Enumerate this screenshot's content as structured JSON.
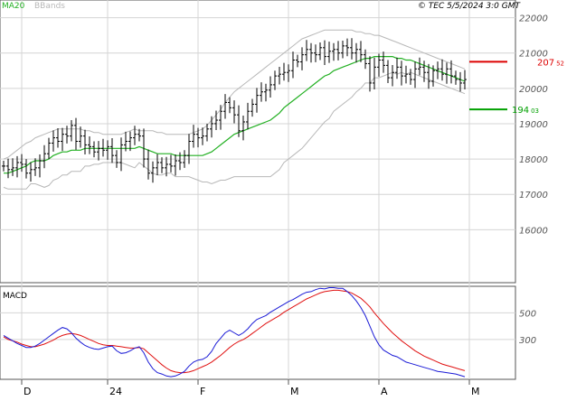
{
  "header": {
    "legend_ma20": "MA20",
    "legend_bbands": "BBands",
    "copyright": "© TEC 5/5/2024 3:0 GMT"
  },
  "colors": {
    "ma20": "#22b022",
    "bbands": "#b8b8b8",
    "macd_line": "#1a1ad6",
    "signal_line": "#e01010",
    "bars": "#000000",
    "resistance": "#dd0000",
    "support": "#00a000",
    "grid": "#d4d4d4"
  },
  "chart_data": [
    {
      "type": "line",
      "subtype": "ohlc-bars",
      "ylim": [
        14500,
        22500
      ],
      "ytick_values": [
        16000,
        17000,
        18000,
        19000,
        20000,
        21000,
        22000
      ],
      "ytick_labels": [
        "16000",
        "17000",
        "18000",
        "19000",
        "20000",
        "21000",
        "22000"
      ],
      "xtick_labels": [
        "D",
        "24",
        "F",
        "M",
        "A",
        "M"
      ],
      "xtick_index": [
        4,
        23,
        43,
        63,
        83,
        103
      ],
      "grid": true,
      "close": [
        17800,
        17700,
        17750,
        17900,
        17850,
        17600,
        17700,
        17750,
        17950,
        18150,
        18450,
        18600,
        18500,
        18700,
        18650,
        18950,
        18500,
        18650,
        18400,
        18350,
        18200,
        18300,
        18250,
        18350,
        18100,
        17900,
        18400,
        18500,
        18600,
        18700,
        18650,
        18000,
        17600,
        17750,
        17900,
        17750,
        17850,
        17800,
        17950,
        17900,
        18100,
        18500,
        18700,
        18600,
        18650,
        18850,
        19000,
        19100,
        19350,
        19600,
        19450,
        19250,
        18800,
        19050,
        19350,
        19550,
        19800,
        19900,
        19950,
        20100,
        20350,
        20400,
        20450,
        20500,
        20800,
        20750,
        20950,
        21100,
        21000,
        20950,
        21150,
        20900,
        21050,
        21100,
        21000,
        21200,
        21150,
        21000,
        21100,
        20950,
        20700,
        20150,
        20600,
        20800,
        20650,
        20300,
        20450,
        20600,
        20350,
        20400,
        20250,
        20550,
        20600,
        20450,
        20200,
        20500,
        20550,
        20400,
        20550,
        20350,
        20250,
        20150,
        20250
      ],
      "ma20": [
        17600,
        17600,
        17650,
        17700,
        17750,
        17800,
        17900,
        17950,
        17950,
        17950,
        18000,
        18100,
        18150,
        18200,
        18200,
        18250,
        18250,
        18250,
        18300,
        18300,
        18300,
        18300,
        18300,
        18300,
        18300,
        18300,
        18300,
        18300,
        18300,
        18300,
        18350,
        18300,
        18250,
        18200,
        18150,
        18150,
        18150,
        18150,
        18100,
        18100,
        18100,
        18100,
        18100,
        18100,
        18100,
        18150,
        18200,
        18300,
        18400,
        18500,
        18600,
        18700,
        18750,
        18800,
        18850,
        18900,
        18950,
        19000,
        19050,
        19100,
        19200,
        19300,
        19450,
        19550,
        19650,
        19750,
        19850,
        19950,
        20050,
        20150,
        20250,
        20350,
        20400,
        20500,
        20550,
        20600,
        20650,
        20700,
        20750,
        20800,
        20850,
        20850,
        20900,
        20900,
        20900,
        20900,
        20900,
        20850,
        20850,
        20800,
        20800,
        20750,
        20700,
        20650,
        20600,
        20550,
        20500,
        20450,
        20400,
        20350,
        20300,
        20250,
        20200
      ],
      "bb_upper": [
        18000,
        18050,
        18150,
        18250,
        18350,
        18450,
        18500,
        18600,
        18650,
        18700,
        18750,
        18800,
        18850,
        18850,
        18850,
        18850,
        18850,
        18850,
        18800,
        18800,
        18750,
        18750,
        18700,
        18700,
        18700,
        18700,
        18700,
        18750,
        18800,
        18850,
        18800,
        18800,
        18800,
        18800,
        18750,
        18750,
        18700,
        18700,
        18700,
        18700,
        18700,
        18700,
        18750,
        18800,
        18850,
        18950,
        19100,
        19250,
        19400,
        19600,
        19750,
        19900,
        20000,
        20100,
        20200,
        20300,
        20400,
        20500,
        20600,
        20700,
        20800,
        20900,
        21000,
        21100,
        21200,
        21300,
        21400,
        21450,
        21500,
        21550,
        21600,
        21650,
        21650,
        21650,
        21650,
        21650,
        21650,
        21650,
        21600,
        21600,
        21550,
        21550,
        21500,
        21500,
        21450,
        21400,
        21350,
        21300,
        21250,
        21200,
        21150,
        21100,
        21050,
        21000,
        20950,
        20900,
        20850,
        20800,
        20750,
        20700,
        20650,
        20600,
        20550
      ],
      "bb_lower": [
        17200,
        17150,
        17150,
        17150,
        17150,
        17150,
        17300,
        17300,
        17250,
        17200,
        17250,
        17400,
        17450,
        17550,
        17550,
        17650,
        17650,
        17650,
        17800,
        17800,
        17850,
        17850,
        17900,
        17900,
        17900,
        17900,
        17900,
        17850,
        17800,
        17750,
        17900,
        17800,
        17700,
        17600,
        17550,
        17550,
        17600,
        17600,
        17500,
        17500,
        17500,
        17500,
        17450,
        17400,
        17350,
        17350,
        17300,
        17350,
        17400,
        17400,
        17450,
        17500,
        17500,
        17500,
        17500,
        17500,
        17500,
        17500,
        17500,
        17500,
        17600,
        17700,
        17900,
        18000,
        18100,
        18200,
        18300,
        18450,
        18600,
        18750,
        18900,
        19050,
        19150,
        19350,
        19450,
        19550,
        19650,
        19750,
        19900,
        20000,
        20150,
        20150,
        20300,
        20300,
        20350,
        20400,
        20450,
        20400,
        20450,
        20400,
        20450,
        20400,
        20350,
        20300,
        20250,
        20200,
        20150,
        20100,
        20050,
        20000,
        19950,
        19900,
        19850
      ],
      "levels": [
        {
          "name": "resistance",
          "value": 20752,
          "label_int": "207",
          "label_dec": "52"
        },
        {
          "name": "support",
          "value": 19403,
          "label_int": "194",
          "label_dec": "03"
        }
      ]
    },
    {
      "type": "line",
      "title": "MACD",
      "ylim": [
        0,
        700
      ],
      "ytick_values": [
        300,
        500
      ],
      "ytick_labels": [
        "300",
        "500"
      ],
      "macd": [
        330,
        310,
        290,
        270,
        255,
        240,
        240,
        250,
        270,
        295,
        320,
        345,
        370,
        390,
        380,
        350,
        310,
        280,
        255,
        240,
        230,
        225,
        235,
        245,
        250,
        215,
        195,
        200,
        215,
        235,
        245,
        200,
        130,
        80,
        50,
        40,
        25,
        20,
        25,
        40,
        60,
        100,
        130,
        145,
        150,
        170,
        210,
        270,
        310,
        350,
        370,
        350,
        330,
        350,
        380,
        420,
        450,
        465,
        480,
        505,
        525,
        545,
        565,
        585,
        600,
        620,
        640,
        655,
        660,
        675,
        685,
        680,
        690,
        690,
        685,
        685,
        660,
        630,
        590,
        540,
        480,
        400,
        320,
        260,
        220,
        200,
        180,
        170,
        150,
        130,
        120,
        110,
        100,
        90,
        80,
        70,
        60,
        55,
        50,
        45,
        40,
        30,
        20
      ],
      "signal": [
        320,
        300,
        290,
        280,
        265,
        255,
        245,
        245,
        255,
        265,
        280,
        295,
        315,
        330,
        340,
        345,
        340,
        330,
        315,
        300,
        285,
        270,
        260,
        255,
        255,
        250,
        245,
        240,
        235,
        235,
        240,
        230,
        200,
        170,
        140,
        110,
        85,
        65,
        55,
        50,
        50,
        55,
        65,
        80,
        95,
        110,
        130,
        155,
        180,
        210,
        240,
        265,
        285,
        300,
        320,
        345,
        370,
        395,
        420,
        440,
        460,
        480,
        505,
        525,
        545,
        565,
        585,
        605,
        620,
        635,
        650,
        660,
        665,
        670,
        670,
        665,
        660,
        650,
        630,
        610,
        580,
        545,
        500,
        460,
        420,
        385,
        350,
        320,
        290,
        265,
        240,
        215,
        195,
        175,
        160,
        145,
        130,
        115,
        105,
        95,
        85,
        75,
        65
      ]
    }
  ]
}
